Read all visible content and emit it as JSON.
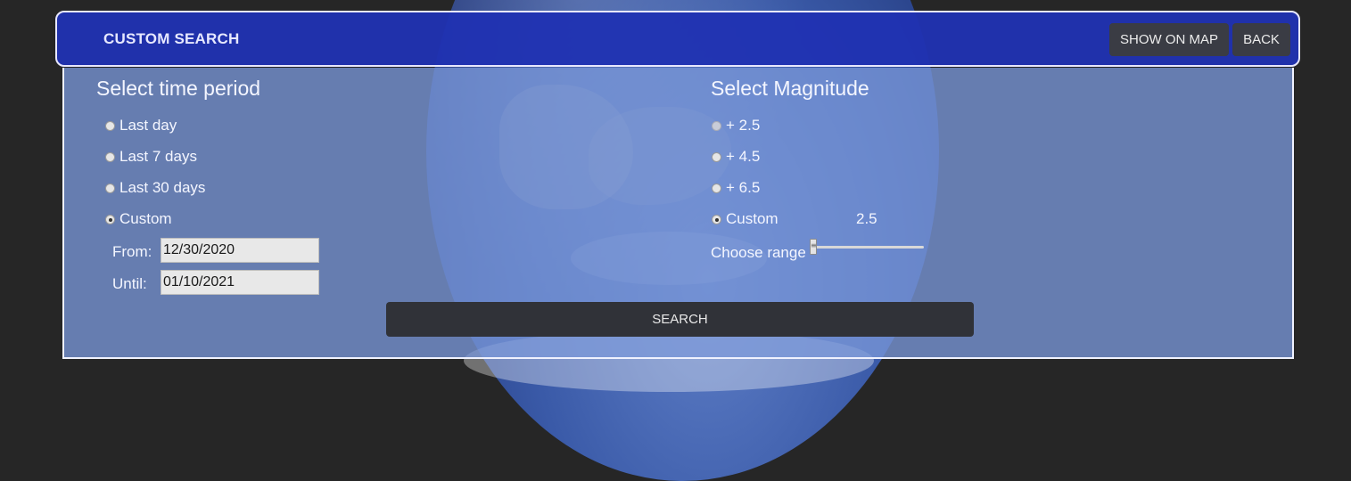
{
  "header": {
    "title": "CUSTOM SEARCH",
    "show_on_map_label": "SHOW ON MAP",
    "back_label": "BACK"
  },
  "time_period": {
    "title": "Select time period",
    "options": [
      {
        "label": "Last day",
        "checked": false
      },
      {
        "label": "Last 7 days",
        "checked": false
      },
      {
        "label": "Last 30 days",
        "checked": false
      },
      {
        "label": "Custom",
        "checked": true
      }
    ],
    "from_label": "From:",
    "from_value": "12/30/2020",
    "until_label": "Until:",
    "until_value": "01/10/2021"
  },
  "magnitude": {
    "title": "Select Magnitude",
    "options": [
      {
        "label": "+ 2.5",
        "checked": false
      },
      {
        "label": "+ 4.5",
        "checked": false
      },
      {
        "label": "+ 6.5",
        "checked": false
      },
      {
        "label": "Custom",
        "checked": true
      }
    ],
    "custom_value": "2.5",
    "range_label": "Choose range",
    "slider_level": 0
  },
  "search_label": "SEARCH",
  "colors": {
    "header_bg": "#2032b2",
    "panel_bg": "#7896d7",
    "button_bg": "#3a3c44"
  }
}
